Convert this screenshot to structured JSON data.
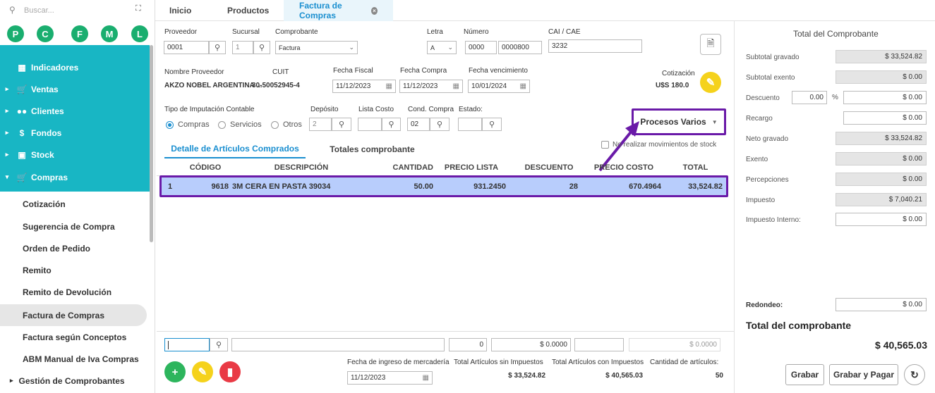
{
  "sidebar": {
    "search_placeholder": "Buscar...",
    "circles": [
      "P",
      "C",
      "F",
      "M",
      "L"
    ],
    "top_items": [
      {
        "label": "Indicadores",
        "icon": "dashboard-icon"
      },
      {
        "label": "Ventas",
        "icon": "cart-icon"
      },
      {
        "label": "Clientes",
        "icon": "people-icon"
      },
      {
        "label": "Fondos",
        "icon": "dollar-icon"
      },
      {
        "label": "Stock",
        "icon": "box-icon"
      },
      {
        "label": "Compras",
        "icon": "basket-icon"
      }
    ],
    "sub_items": [
      "Cotización",
      "Sugerencia de Compra",
      "Orden de Pedido",
      "Remito",
      "Remito de Devolución",
      "Factura de Compras",
      "Factura según Conceptos",
      "ABM Manual de Iva Compras",
      "Gestión de Comprobantes"
    ],
    "active_sub": "Factura de Compras"
  },
  "tabs": {
    "inicio": "Inicio",
    "productos": "Productos",
    "factura": "Factura de Compras"
  },
  "form": {
    "proveedor_label": "Proveedor",
    "proveedor_value": "0001",
    "sucursal_label": "Sucursal",
    "sucursal_value": "1",
    "comprobante_label": "Comprobante",
    "comprobante_value": "Factura",
    "letra_label": "Letra",
    "letra_value": "A",
    "numero_label": "Número",
    "numero_a": "0000",
    "numero_b": "0000800",
    "cai_label": "CAI / CAE",
    "cai_value": "3232",
    "nombre_label": "Nombre Proveedor",
    "nombre_value": "AKZO NOBEL ARGENTINA ...",
    "cuit_label": "CUIT",
    "cuit_value": "30-50052945-4",
    "fecha_fiscal_label": "Fecha Fiscal",
    "fecha_fiscal_value": "11/12/2023",
    "fecha_compra_label": "Fecha Compra",
    "fecha_compra_value": "11/12/2023",
    "fecha_venc_label": "Fecha vencimiento",
    "fecha_venc_value": "10/01/2024",
    "cotizacion_label": "Cotización",
    "cotizacion_value": "U$S 180.0",
    "tipo_label": "Tipo de Imputación Contable",
    "radio_compras": "Compras",
    "radio_servicios": "Servicios",
    "radio_otros": "Otros",
    "deposito_label": "Depósito",
    "deposito_value": "2",
    "lista_label": "Lista Costo",
    "cond_label": "Cond. Compra",
    "cond_value": "02",
    "estado_label": "Estado:",
    "procesos_label": "Procesos Varios",
    "no_realizar_label": "No realizar movimientos de stock"
  },
  "subtabs": {
    "detalle": "Detalle de Artículos Comprados",
    "totales": "Totales comprobante"
  },
  "table": {
    "headers": [
      "CÓDIGO",
      "DESCRIPCIÓN",
      "CANTIDAD",
      "PRECIO LISTA",
      "DESCUENTO",
      "PRECIO COSTO",
      "TOTAL"
    ],
    "rows": [
      {
        "n": "1",
        "codigo": "9618",
        "descripcion": "3M CERA EN PASTA 39034",
        "cantidad": "50.00",
        "precio_lista": "931.2450",
        "descuento": "28",
        "precio_costo": "670.4964",
        "total": "33,524.82"
      }
    ]
  },
  "bottom": {
    "qty": "0",
    "price": "$ 0.0000",
    "total": "$ 0.0000",
    "fecha_ingreso_label": "Fecha de ingreso de mercadería",
    "fecha_ingreso_value": "11/12/2023",
    "sin_imp_label": "Total Artículos sin Impuestos",
    "sin_imp_value": "$ 33,524.82",
    "con_imp_label": "Total Artículos con Impuestos",
    "con_imp_value": "$ 40,565.03",
    "cant_label": "Cantidad de artículos:",
    "cant_value": "50"
  },
  "totals": {
    "title": "Total del Comprobante",
    "subtotal_gravado_label": "Subtotal gravado",
    "subtotal_gravado": "$ 33,524.82",
    "subtotal_exento_label": "Subtotal exento",
    "subtotal_exento": "$ 0.00",
    "descuento_label": "Descuento",
    "descuento_pct": "0.00",
    "pct_sign": "%",
    "descuento": "$ 0.00",
    "recargo_label": "Recargo",
    "recargo": "$ 0.00",
    "neto_label": "Neto gravado",
    "neto": "$ 33,524.82",
    "exento_label": "Exento",
    "exento": "$ 0.00",
    "percepciones_label": "Percepciones",
    "percepciones": "$ 0.00",
    "impuesto_label": "Impuesto",
    "impuesto": "$ 7,040.21",
    "impuesto_interno_label": "Impuesto Interno:",
    "impuesto_interno": "$ 0.00",
    "redondeo_label": "Redondeo:",
    "redondeo": "$ 0.00",
    "total_label": "Total del comprobante",
    "total": "$ 40,565.03",
    "grabar": "Grabar",
    "grabar_pagar": "Grabar y Pagar"
  },
  "colors": {
    "teal": "#18b6c4",
    "green": "#1aae6f",
    "blue": "#1a8fd0",
    "purple": "#6a1aa8",
    "row_sel": "#b8cdfc"
  }
}
